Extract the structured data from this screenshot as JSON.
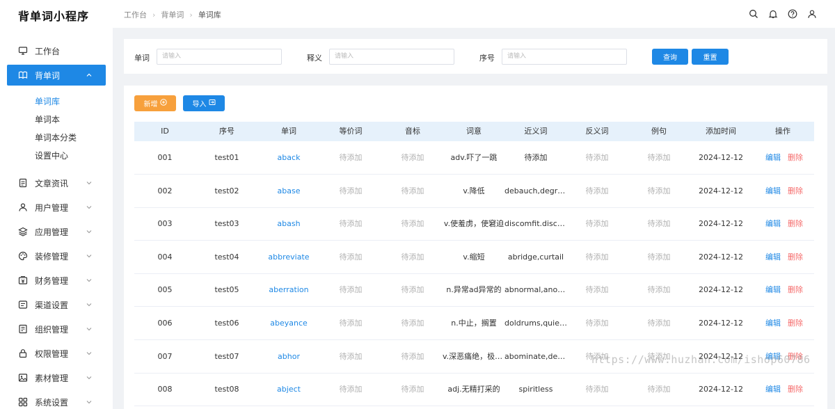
{
  "app": {
    "title": "背单词小程序"
  },
  "sidebar": {
    "items": [
      {
        "label": "工作台",
        "icon": "monitor-icon"
      },
      {
        "label": "背单词",
        "icon": "book-icon",
        "active": true
      },
      {
        "label": "文章资讯",
        "icon": "document-icon"
      },
      {
        "label": "用户管理",
        "icon": "user-icon"
      },
      {
        "label": "应用管理",
        "icon": "layers-icon"
      },
      {
        "label": "装修管理",
        "icon": "palette-icon"
      },
      {
        "label": "财务管理",
        "icon": "wallet-icon"
      },
      {
        "label": "渠道设置",
        "icon": "channel-icon"
      },
      {
        "label": "组织管理",
        "icon": "org-icon"
      },
      {
        "label": "权限管理",
        "icon": "lock-icon"
      },
      {
        "label": "素材管理",
        "icon": "image-icon"
      },
      {
        "label": "系统设置",
        "icon": "apps-icon"
      }
    ],
    "subitems": [
      "单词库",
      "单词本",
      "单词本分类",
      "设置中心"
    ]
  },
  "header": {
    "breadcrumb": [
      "工作台",
      "背单词",
      "单词库"
    ],
    "icons": [
      "search-icon",
      "bell-icon",
      "help-icon",
      "avatar-icon"
    ]
  },
  "search": {
    "word_label": "单词",
    "word_placeholder": "请输入",
    "meaning_label": "释义",
    "meaning_placeholder": "请输入",
    "index_label": "序号",
    "index_placeholder": "请输入",
    "query_label": "查询",
    "reset_label": "重置"
  },
  "toolbar": {
    "add_label": "新增",
    "import_label": "导入"
  },
  "table": {
    "headers": [
      "ID",
      "序号",
      "单词",
      "等价词",
      "音标",
      "词意",
      "近义词",
      "反义词",
      "例句",
      "添加时间",
      "操作"
    ],
    "edit_label": "编辑",
    "delete_label": "删除",
    "rows": [
      {
        "id": "001",
        "seq": "test01",
        "word": "aback",
        "equiv": "待添加",
        "phonetic": "待添加",
        "meaning": "adv.吓了一跳",
        "synonym": "待添加",
        "antonym": "待添加",
        "example": "待添加",
        "date": "2024-12-12"
      },
      {
        "id": "002",
        "seq": "test02",
        "word": "abase",
        "equiv": "待添加",
        "phonetic": "待添加",
        "meaning": "v.降低",
        "synonym": "debauch,degrade",
        "antonym": "待添加",
        "example": "待添加",
        "date": "2024-12-12"
      },
      {
        "id": "003",
        "seq": "test03",
        "word": "abash",
        "equiv": "待添加",
        "phonetic": "待添加",
        "meaning": "v.使羞虏，使窘迫",
        "synonym": "discomfit.discon...",
        "antonym": "待添加",
        "example": "待添加",
        "date": "2024-12-12"
      },
      {
        "id": "004",
        "seq": "test04",
        "word": "abbreviate",
        "equiv": "待添加",
        "phonetic": "待添加",
        "meaning": "v.缩短",
        "synonym": "abridge,curtail",
        "antonym": "待添加",
        "example": "待添加",
        "date": "2024-12-12"
      },
      {
        "id": "005",
        "seq": "test05",
        "word": "aberration",
        "equiv": "待添加",
        "phonetic": "待添加",
        "meaning": "n.异常ad异常的",
        "synonym": "abnormal,anom...",
        "antonym": "待添加",
        "example": "待添加",
        "date": "2024-12-12"
      },
      {
        "id": "006",
        "seq": "test06",
        "word": "abeyance",
        "equiv": "待添加",
        "phonetic": "待添加",
        "meaning": "n.中止，搁置",
        "synonym": "doldrums,quiesc...",
        "antonym": "待添加",
        "example": "待添加",
        "date": "2024-12-12"
      },
      {
        "id": "007",
        "seq": "test07",
        "word": "abhor",
        "equiv": "待添加",
        "phonetic": "待添加",
        "meaning": "v.深恶痛绝，极度...",
        "synonym": "abominate,despi...",
        "antonym": "待添加",
        "example": "待添加",
        "date": "2024-12-12"
      },
      {
        "id": "008",
        "seq": "test08",
        "word": "abject",
        "equiv": "待添加",
        "phonetic": "待添加",
        "meaning": "adj.无精打采的",
        "synonym": "spiritless",
        "antonym": "待添加",
        "example": "待添加",
        "date": "2024-12-12"
      }
    ]
  },
  "watermark": "https://www.huzhan.com/ishop60786",
  "colors": {
    "primary": "#1e88e5",
    "add_button": "#f7a03c",
    "delete": "#f56c6c",
    "pending": "#b0b0b0",
    "table_header": "#e6f1fb"
  }
}
